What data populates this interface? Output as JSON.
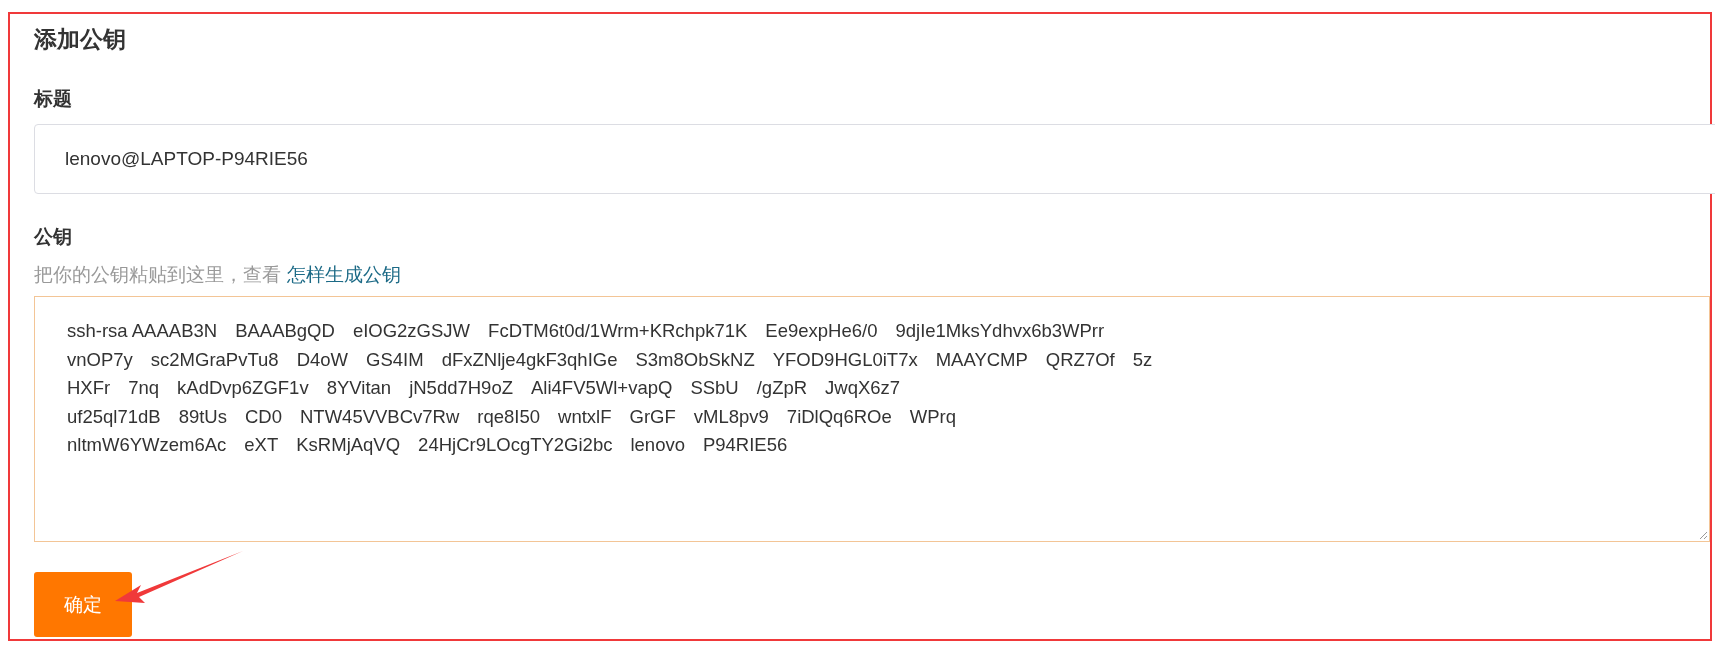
{
  "heading": "添加公钥",
  "title_field": {
    "label": "标题",
    "value": "lenovo@LAPTOP-P94RIE56"
  },
  "key_field": {
    "label": "公钥",
    "hint": "把你的公钥粘贴到这里，查看",
    "hint_link": "怎样生成公钥",
    "lines": [
      [
        "ssh-rsa AAAAB3N",
        "BAAABgQD",
        "eIOG2zGSJW",
        "FcDTM6t0d/1Wrm+KRchpk71K",
        "Ee9expHe6/0",
        "9djIe1MksYdhvx6b3WPrr"
      ],
      [
        "vnOP7y",
        "sc2MGraPvTu8",
        "D4oW",
        "GS4IM",
        "dFxZNlje4gkF3qhIGe",
        "S3m8ObSkNZ",
        "YFOD9HGL0iT7x",
        "MAAYCMP",
        "QRZ7Of",
        "5z"
      ],
      [
        "HXFr",
        "7nq",
        "kAdDvp6ZGF1v",
        "8YVitan",
        "jN5dd7H9oZ",
        "Ali4FV5Wl+vapQ",
        "SSbU",
        "/gZpR",
        "JwqX6z7"
      ],
      [
        "uf25ql71dB",
        "89tUs",
        "CD0",
        "NTW45VVBCv7Rw",
        "rqe8I50",
        "wntxlF",
        "GrGF",
        "vML8pv9",
        "7iDlQq6ROe",
        "WPrq"
      ],
      [
        "nltmW6YWzem6Ac",
        "eXT",
        "KsRMjAqVQ",
        "24HjCr9LOcgTY2Gi2bc",
        "lenovo",
        "P94RIE56"
      ]
    ]
  },
  "submit_button": "确定"
}
